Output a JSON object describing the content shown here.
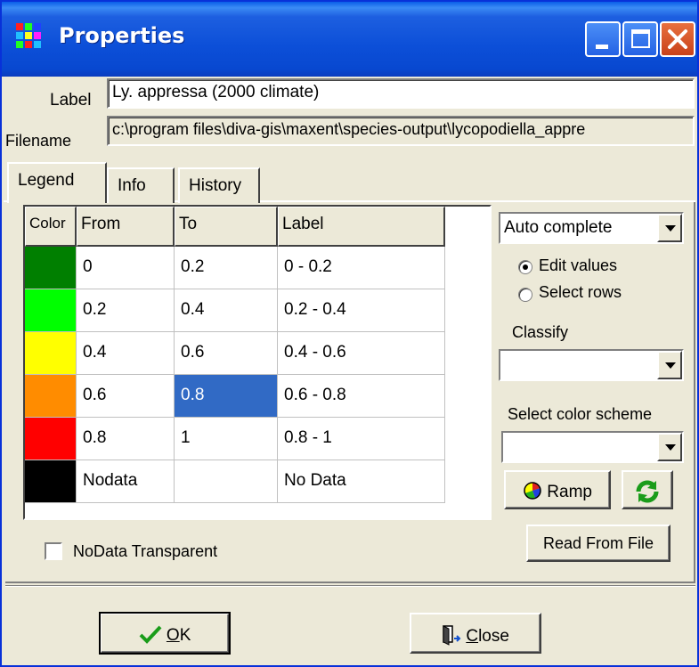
{
  "window": {
    "title": "Properties"
  },
  "form": {
    "label_caption": "Label",
    "label_value": "Ly. appressa (2000 climate)",
    "filename_caption": "Filename",
    "filename_value": "c:\\program files\\diva-gis\\maxent\\species-output\\lycopodiella_appre"
  },
  "tabs": [
    {
      "label": "Legend",
      "active": true
    },
    {
      "label": "Info",
      "active": false
    },
    {
      "label": "History",
      "active": false
    }
  ],
  "grid": {
    "headers": [
      "Color",
      "From",
      "To",
      "Label"
    ],
    "rows": [
      {
        "color": "#007f00",
        "from": "0",
        "to": "0.2",
        "label": "0 - 0.2"
      },
      {
        "color": "#00ff00",
        "from": "0.2",
        "to": "0.4",
        "label": "0.2 - 0.4"
      },
      {
        "color": "#ffff00",
        "from": "0.4",
        "to": "0.6",
        "label": "0.4 - 0.6"
      },
      {
        "color": "#ff8c00",
        "from": "0.6",
        "to": "0.8",
        "label": "0.6 - 0.8",
        "selected_col": "to"
      },
      {
        "color": "#ff0000",
        "from": "0.8",
        "to": "1",
        "label": "0.8 - 1"
      },
      {
        "color": "#000000",
        "from": "Nodata",
        "to": "",
        "label": "No Data"
      }
    ]
  },
  "controls": {
    "auto_complete": "Auto complete",
    "radio_edit": "Edit values",
    "radio_select": "Select rows",
    "classify_label": "Classify",
    "classify_value": "",
    "scheme_label": "Select color scheme",
    "scheme_value": "",
    "ramp_button": "Ramp",
    "read_button": "Read From File",
    "nodata_transparent": "NoData Transparent",
    "nodata_checked": false
  },
  "footer": {
    "ok_mnemonic": "O",
    "ok_rest": "K",
    "close_mnemonic": "C",
    "close_rest": "lose"
  },
  "colors": {
    "titlebar": "#0a4fd8",
    "selection": "#316ac5",
    "ok_check": "#1a9c1a"
  }
}
